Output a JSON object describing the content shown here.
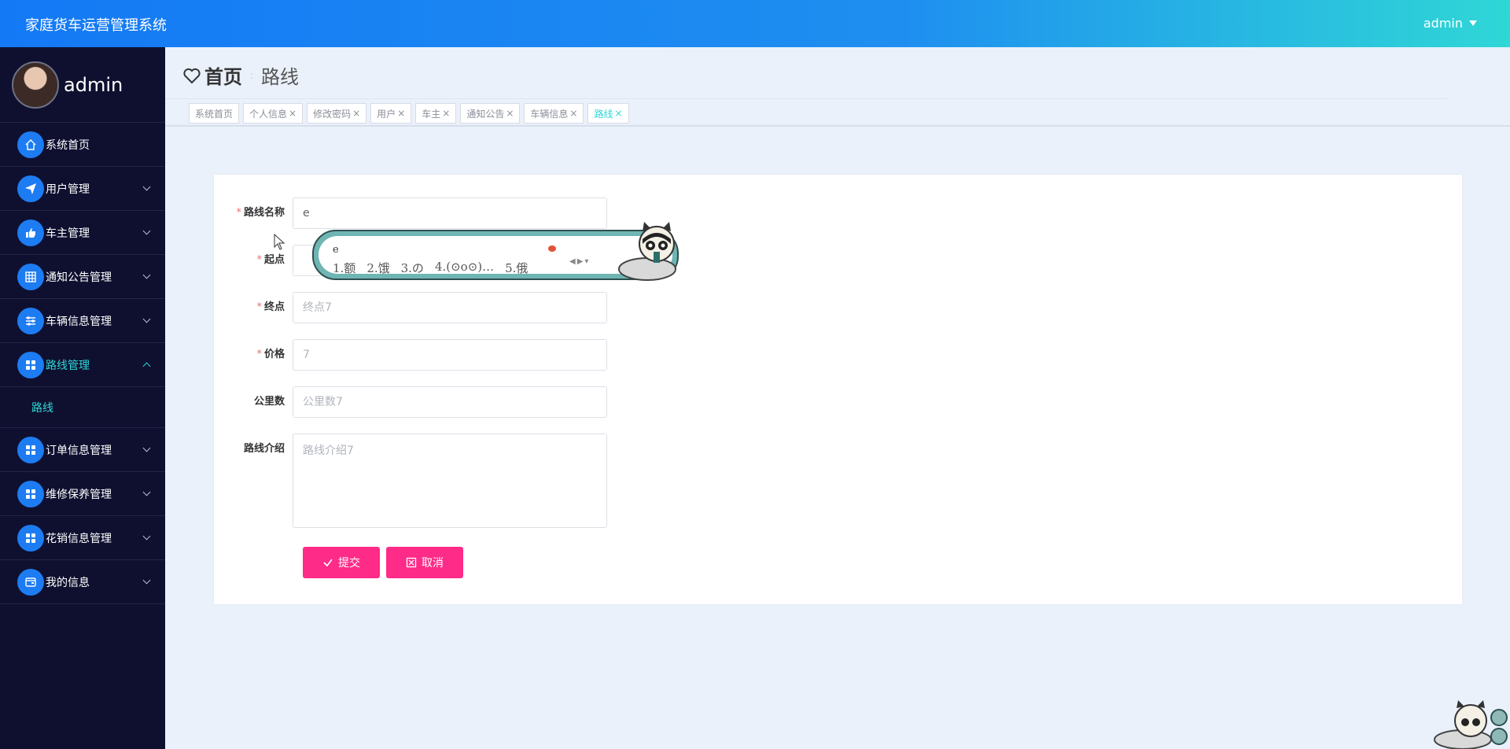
{
  "header": {
    "app_title": "家庭货车运营管理系统",
    "user": "admin"
  },
  "sidebar": {
    "username": "admin",
    "items": [
      {
        "label": "系统首页",
        "icon": "home-icon"
      },
      {
        "label": "用户管理",
        "icon": "send-icon"
      },
      {
        "label": "车主管理",
        "icon": "thumbs-up-icon"
      },
      {
        "label": "通知公告管理",
        "icon": "grid-icon"
      },
      {
        "label": "车辆信息管理",
        "icon": "sliders-icon"
      },
      {
        "label": "路线管理",
        "icon": "apps-icon"
      },
      {
        "label": "订单信息管理",
        "icon": "apps-icon"
      },
      {
        "label": "维修保养管理",
        "icon": "apps-icon"
      },
      {
        "label": "花销信息管理",
        "icon": "apps-icon"
      },
      {
        "label": "我的信息",
        "icon": "wallet-icon"
      }
    ],
    "submenu_label": "路线"
  },
  "breadcrumb": {
    "home": "首页",
    "separator": ":",
    "current": "路线"
  },
  "tags": [
    {
      "label": "系统首页",
      "closable": false
    },
    {
      "label": "个人信息",
      "closable": true
    },
    {
      "label": "修改密码",
      "closable": true
    },
    {
      "label": "用户",
      "closable": true
    },
    {
      "label": "车主",
      "closable": true
    },
    {
      "label": "通知公告",
      "closable": true
    },
    {
      "label": "车辆信息",
      "closable": true
    },
    {
      "label": "路线",
      "closable": true,
      "active": true
    }
  ],
  "tag_close": "×",
  "form": {
    "required_mark": "*",
    "route_name": {
      "label": "路线名称",
      "value": "e"
    },
    "start": {
      "label": "起点",
      "value": ""
    },
    "end": {
      "label": "终点",
      "placeholder": "终点7"
    },
    "price": {
      "label": "价格",
      "placeholder": "7"
    },
    "distance": {
      "label": "公里数",
      "placeholder": "公里数7"
    },
    "intro": {
      "label": "路线介绍",
      "placeholder": "路线介绍7"
    },
    "submit_label": "提交",
    "cancel_label": "取消"
  },
  "ime": {
    "composition": "e",
    "candidates": [
      "1.额",
      "2.饿",
      "3.の",
      "4.(⊙o⊙)…",
      "5.俄"
    ]
  },
  "colors": {
    "header_start": "#1479f5",
    "header_end": "#2fd7d6",
    "sidebar_bg": "#0f1030",
    "accent": "#2fd7d6",
    "button": "#ff2b88"
  }
}
